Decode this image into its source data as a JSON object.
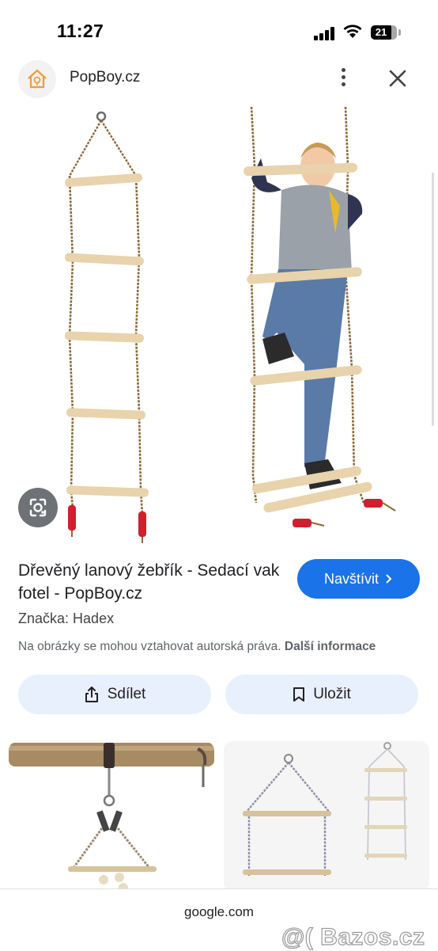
{
  "status_bar": {
    "time": "11:27",
    "battery": "21"
  },
  "header": {
    "site_name": "PopBoy.cz"
  },
  "result": {
    "title": "Dřevěný lanový žebřík - Sedací vak fotel - PopBoy.cz",
    "visit_label": "Navštívit",
    "brand_label": "Značka:",
    "brand_value": "Hadex",
    "copyright_text": "Na obrázky se mohou vztahovat autorská práva.",
    "more_info_label": "Další informace"
  },
  "actions": {
    "share_label": "Sdílet",
    "save_label": "Uložit"
  },
  "bottom": {
    "url": "google.com",
    "watermark": "@( Bazos.cz"
  },
  "colors": {
    "accent": "#1a73e8",
    "tonal_button": "#e8f0fe",
    "rope": "#8a6a3a",
    "wood": "#e8d3ac",
    "rope_knot": "#d01f2e"
  }
}
